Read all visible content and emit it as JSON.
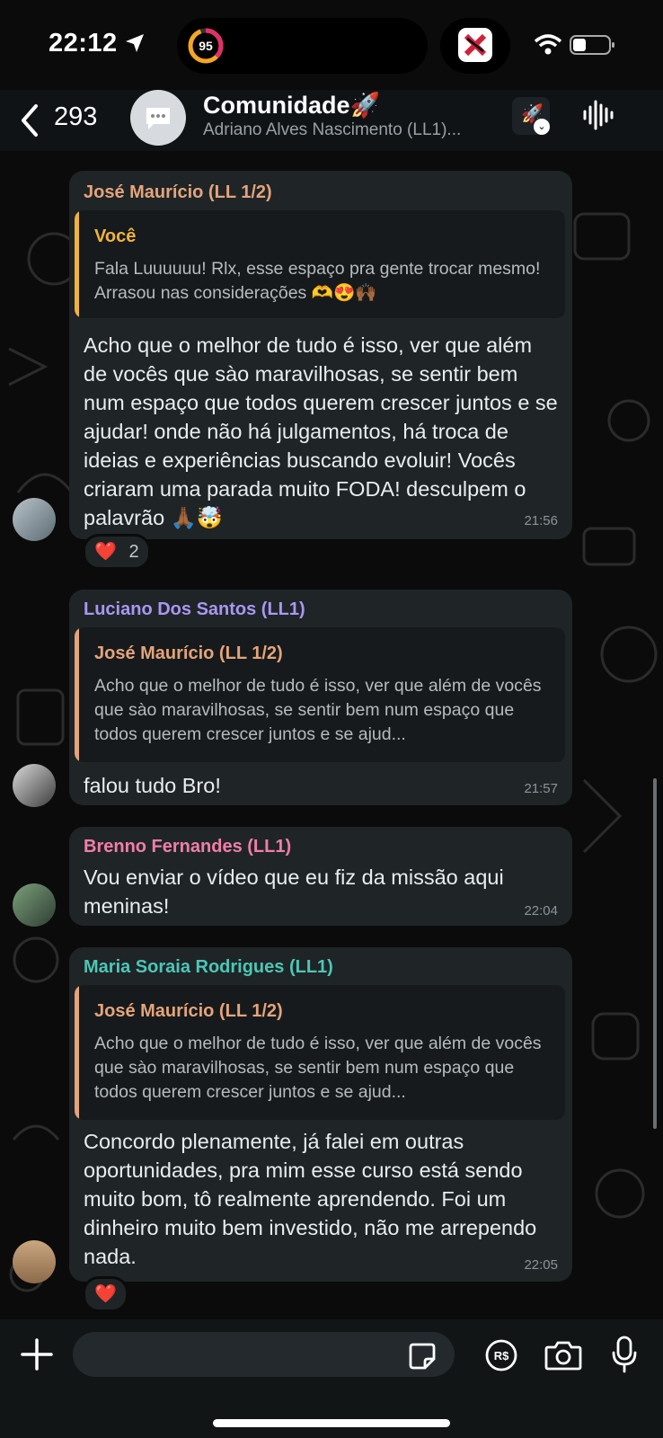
{
  "status_bar": {
    "time": "22:12",
    "ring_value": "95"
  },
  "header": {
    "back_count": "293",
    "title": "Comunidade🚀",
    "subtitle": "Adriano Alves Nascimento (LL1)..."
  },
  "messages": [
    {
      "sender": "José Maurício (LL 1/2)",
      "sender_color": "#e5a47a",
      "quote": {
        "author": "Você",
        "author_color": "#f1b43a",
        "bar_color": "#f1b43a",
        "text": "Fala Luuuuuu! Rlx, esse espaço pra gente trocar mesmo! Arrasou nas considerações 🫶😍🙌🏾"
      },
      "text": "Acho que o melhor de tudo é isso, ver que além de vocês que sào maravilhosas, se sentir bem num espaço que todos querem crescer juntos e se ajudar! onde não há julgamentos, há troca de ideias e experiências buscando evoluir! Vocês criaram uma parada muito FODA! desculpem o palavrão 🙏🏾🤯",
      "time": "21:56",
      "reaction": "❤️",
      "reaction_count": "2"
    },
    {
      "sender": "Luciano Dos Santos (LL1)",
      "sender_color": "#a997f2",
      "quote": {
        "author": "José Maurício (LL 1/2)",
        "author_color": "#e5a47a",
        "bar_color": "#e5a47a",
        "text": "Acho que o melhor de tudo é isso, ver que além de vocês que sào maravilhosas, se sentir bem num espaço que todos querem crescer juntos e se ajud..."
      },
      "text": "falou tudo Bro!",
      "time": "21:57"
    },
    {
      "sender": "Brenno Fernandes (LL1)",
      "sender_color": "#f27ea5",
      "text": "Vou enviar o vídeo que eu fiz da missão aqui meninas!",
      "time": "22:04"
    },
    {
      "sender": "Maria Soraia Rodrigues (LL1)",
      "sender_color": "#4cc7b6",
      "quote": {
        "author": "José Maurício (LL 1/2)",
        "author_color": "#e5a47a",
        "bar_color": "#e5a47a",
        "text": "Acho que o melhor de tudo é isso, ver que além de vocês que sào maravilhosas, se sentir bem num espaço que todos querem crescer juntos e se ajud..."
      },
      "text": "Concordo plenamente,  já falei em outras oportunidades, pra mim esse curso está sendo muito bom, tô realmente aprendendo. Foi um dinheiro muito bem investido, não me arrependo nada.",
      "time": "22:05",
      "reaction": "❤️"
    }
  ],
  "composer": {
    "placeholder": ""
  },
  "icons": {
    "back": "chevron-left-icon",
    "group": "chat-bubble-icon",
    "audio": "waveform-icon",
    "plus": "plus-icon",
    "sticker": "sticker-icon",
    "payment": "real-currency-icon",
    "camera": "camera-icon",
    "mic": "microphone-icon"
  }
}
